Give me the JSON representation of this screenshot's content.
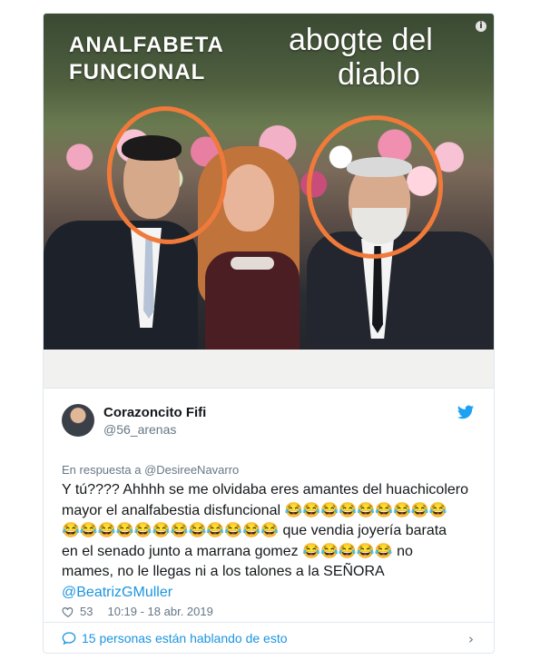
{
  "photo": {
    "label_left": [
      "ANALFABETA",
      "FUNCIONAL"
    ],
    "label_right": [
      "abogte del",
      "diablo"
    ],
    "info_icon": "info-icon",
    "annotation_color": "#f07a3a"
  },
  "tweet": {
    "author_name": "Corazoncito Fifi",
    "author_handle": "@56_arenas",
    "reply_to_prefix": "En respuesta a ",
    "reply_to_user": "@DesireeNavarro",
    "body_line1": "Y tú???? Ahhhh se me olvidaba eres amantes del huachicolero",
    "body_line2": "mayor el analfabestia disfuncional 😂😂😂😂😂😂😂😂😂",
    "body_line3": "😂😂😂😂😂😂😂😂😂😂😂😂 que vendia joyería barata",
    "body_line4": "en el senado junto a marrana gomez  😂😂😂😂😂 no",
    "body_line5": "mames, no le llegas ni a los talones a la SEÑORA",
    "body_mention": "@BeatrizGMuller",
    "likes": "53",
    "timestamp": "10:19 - 18 abr. 2019",
    "footer_text": "15 personas están hablando de esto",
    "chevron": "›",
    "brand_color": "#1da1f2",
    "link_color": "#1b95e0"
  }
}
